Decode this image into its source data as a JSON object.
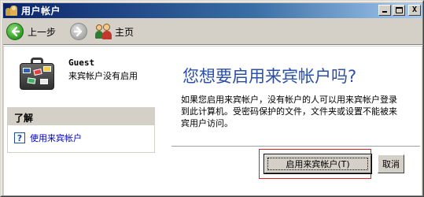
{
  "window": {
    "title": "用户帐户",
    "controls": {
      "minimize": "_",
      "maximize": "□",
      "close": "X"
    }
  },
  "toolbar": {
    "back_label": "上一步",
    "home_label": "主页",
    "icons": {
      "back": "back-arrow-icon",
      "forward": "forward-arrow-icon",
      "home": "users-home-icon"
    }
  },
  "user": {
    "name": "Guest",
    "status": "来宾帐户没有启用",
    "icon": "suitcase-icon"
  },
  "learn": {
    "header": "了解",
    "link_label": "使用来宾帐户",
    "link_icon": "help-icon"
  },
  "main": {
    "heading": "您想要启用来宾帐户吗?",
    "description": "如果您启用来宾帐户，没有帐户的人可以用来宾帐户登录到此计算机。受密码保护的文件，文件夹或设置不能被来宾用户访问。",
    "enable_button": "启用来宾帐户(T)",
    "cancel_button": "取消"
  },
  "colors": {
    "title_gradient_start": "#0a246a",
    "heading": "#2b4fa8",
    "link": "#0000cc",
    "highlight": "#e02020",
    "face": "#d4d0c8"
  }
}
